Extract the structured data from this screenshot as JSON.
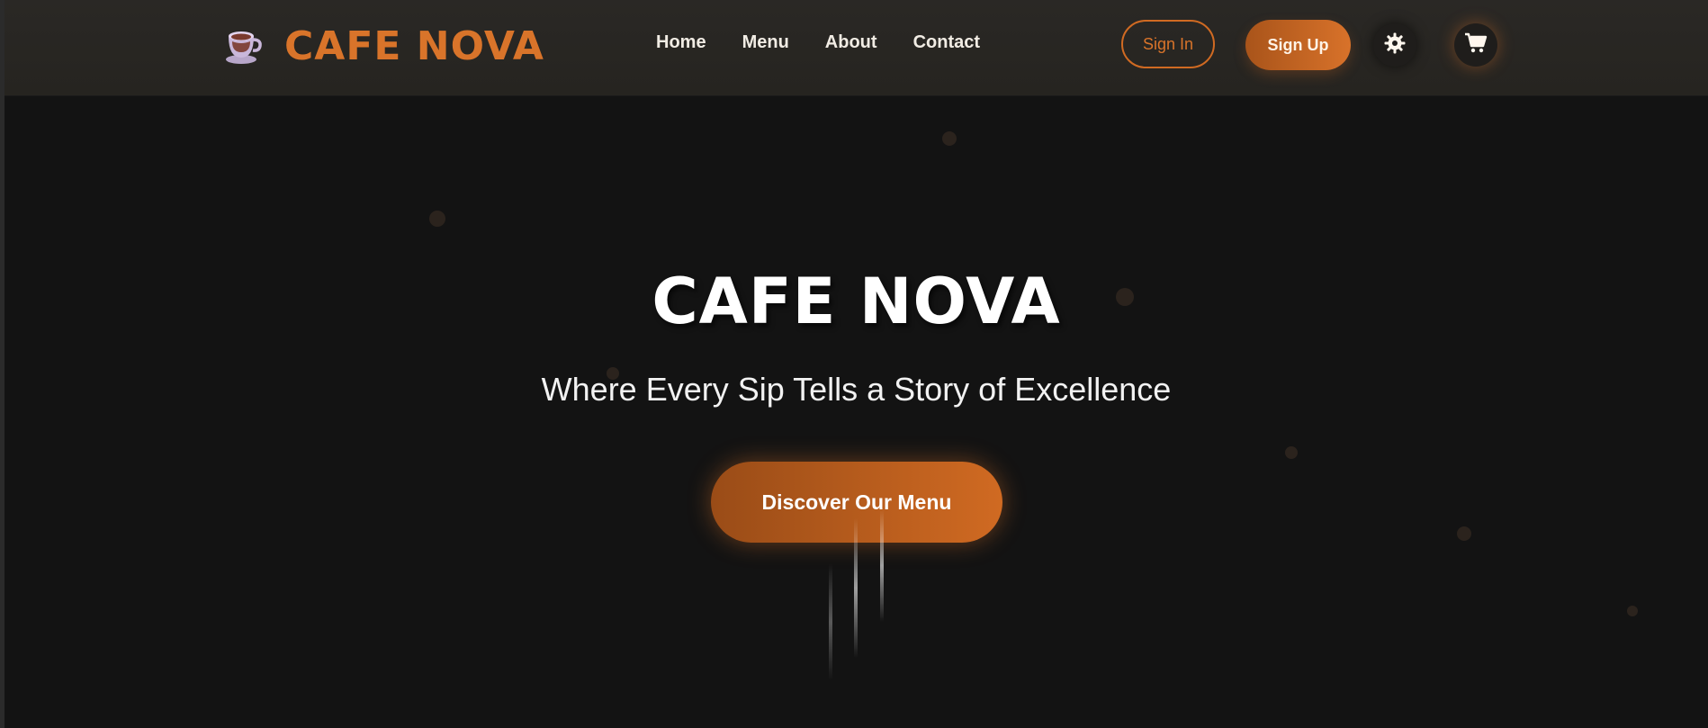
{
  "brand": {
    "name": "CAFE NOVA",
    "logo_icon": "coffee-cup-icon"
  },
  "nav": {
    "links": [
      {
        "label": "Home"
      },
      {
        "label": "Menu"
      },
      {
        "label": "About"
      },
      {
        "label": "Contact"
      }
    ]
  },
  "auth": {
    "signin_label": "Sign In",
    "signup_label": "Sign Up"
  },
  "icons": {
    "theme": "gear-icon",
    "cart": "cart-icon"
  },
  "hero": {
    "title": "CAFE NOVA",
    "subtitle": "Where Every Sip Tells a Story of Excellence",
    "cta_label": "Discover Our Menu"
  },
  "colors": {
    "accent": "#d9742a",
    "background": "#131313",
    "navbar": "#282622",
    "text_light": "#f1ece4"
  }
}
